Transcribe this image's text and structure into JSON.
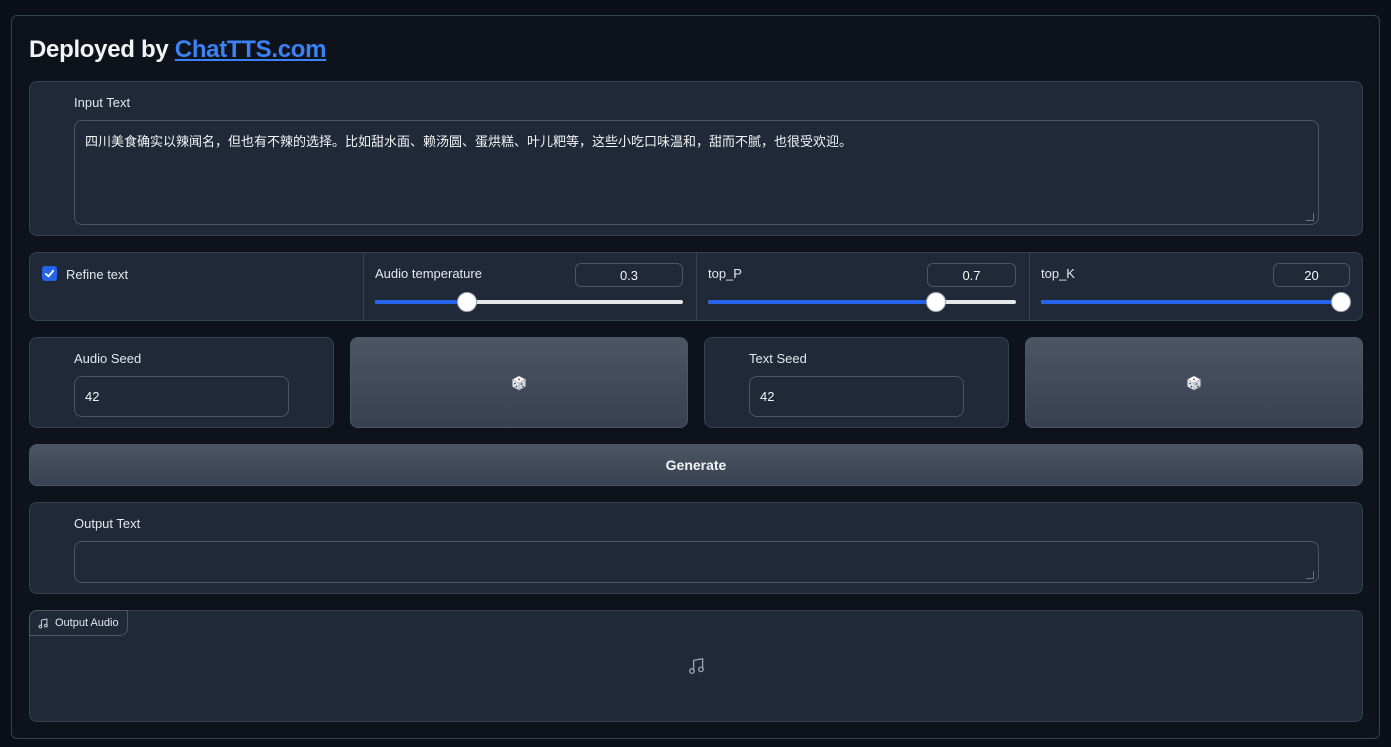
{
  "header": {
    "prefix": "Deployed by ",
    "link": "ChatTTS.com"
  },
  "input": {
    "label": "Input Text",
    "value": "四川美食确实以辣闻名，但也有不辣的选择。比如甜水面、赖汤圆、蛋烘糕、叶儿粑等，这些小吃口味温和，甜而不腻，也很受欢迎。"
  },
  "controls": {
    "refine": {
      "label": "Refine text",
      "checked": true
    },
    "audio_temperature": {
      "label": "Audio temperature",
      "value": "0.3",
      "fraction": 0.3
    },
    "top_p": {
      "label": "top_P",
      "value": "0.7",
      "fraction": 0.74
    },
    "top_k": {
      "label": "top_K",
      "value": "20",
      "fraction": 1.0
    }
  },
  "seeds": {
    "audio": {
      "label": "Audio Seed",
      "value": "42"
    },
    "text": {
      "label": "Text Seed",
      "value": "42"
    },
    "dice_icon": "dice-icon"
  },
  "generate": {
    "label": "Generate"
  },
  "output": {
    "label": "Output Text",
    "value": ""
  },
  "audio": {
    "label": "Output Audio",
    "icon": "music-note-icon"
  },
  "colors": {
    "accent": "#2563eb",
    "link": "#3b82f6",
    "panel": "#1f2937",
    "background": "#0b0f19"
  }
}
